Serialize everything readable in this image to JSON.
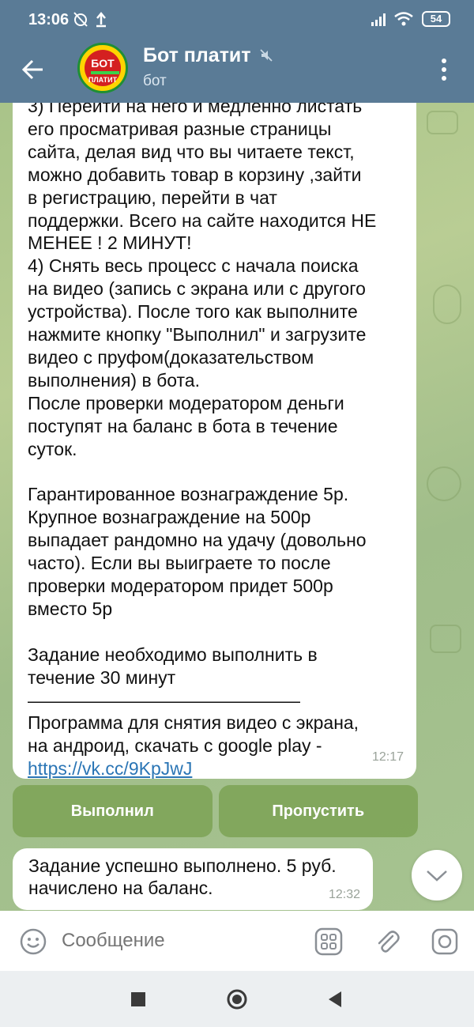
{
  "status": {
    "time": "13:06",
    "battery": "54"
  },
  "header": {
    "title": "Бот платит",
    "subtitle": "бот",
    "avatar_top": "БОТ",
    "avatar_bottom": "ПЛАТИТ"
  },
  "message_main": {
    "text": "3) Перейти на него и медленно листать\nего просматривая разные страницы\nсайта, делая вид что вы читаете текст,\nможно добавить товар в корзину ,зайти\nв регистрацию, перейти в чат\nподдержки. Всего на сайте находится НЕ\nМЕНЕЕ ! 2 МИНУТ!\n4) Снять весь процесс с начала поиска\nна видео (запись с экрана или с другого\nустройства). После того как выполните\nнажмите кнопку \"Выполнил\" и загрузите\nвидео с пруфом(доказательством\nвыполнения) в бота.\nПосле проверки модератором деньги\nпоступят на баланс в бота в течение\nсуток.\n\nГарантированное вознаграждение 5р.\nКрупное вознаграждение на 500р\nвыпадает рандомно на удачу (довольно\nчасто). Если вы выиграете то после\nпроверки модератором придет 500р\nвместо 5р\n\nЗадание необходимо выполнить в\nтечение 30 минут\n———————————————\nПрограмма для снятия видео с экрана,\nна андроид, скачать с google play -",
    "link": "https://vk.cc/9KpJwJ",
    "time": "12:17"
  },
  "keyboard": {
    "done_label": "Выполнил",
    "skip_label": "Пропустить"
  },
  "message_reply": {
    "text": "Задание успешно выполнено. 5 руб.\nначислено на баланс.",
    "time": "12:32"
  },
  "input": {
    "placeholder": "Сообщение"
  },
  "colors": {
    "header": "#5a7b96",
    "keyboard_button": "#7aa050",
    "link": "#2a75b5"
  }
}
